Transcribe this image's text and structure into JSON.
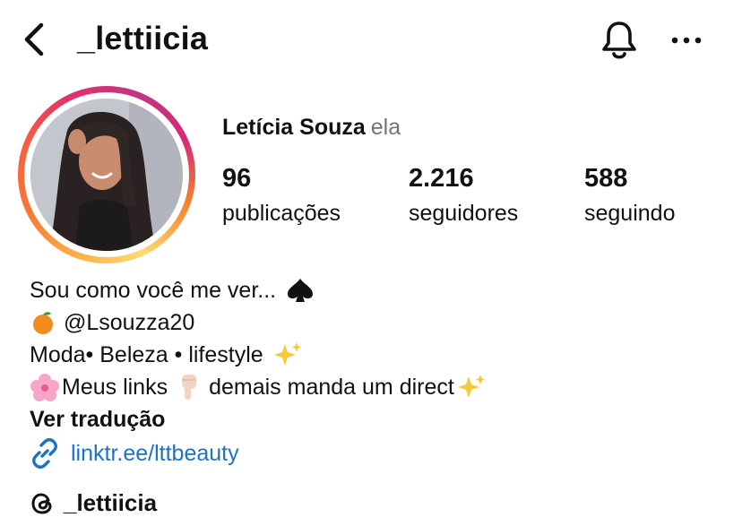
{
  "header": {
    "username": "_lettiicia"
  },
  "profile": {
    "full_name": "Letícia Souza",
    "pronoun": "ela",
    "stats": {
      "posts": {
        "value": "96",
        "label": "publicações"
      },
      "followers": {
        "value": "2.216",
        "label": "seguidores"
      },
      "following": {
        "value": "588",
        "label": "seguindo"
      }
    }
  },
  "bio": {
    "line1": "Sou como você me ver...",
    "line2": "@Lsouzza20",
    "line3": "Moda• Beleza • lifestyle",
    "line4_a": "Meus links",
    "line4_b": "demais manda um direct",
    "translate_label": "Ver tradução",
    "link": "linktr.ee/lttbeauty"
  },
  "threads": {
    "handle": "_lettiicia"
  },
  "colors": {
    "link_blue": "#1a73c6",
    "muted_gray": "#737373",
    "story_ring_start": "#fcaf45",
    "story_ring_end": "#c13584"
  },
  "icons": {
    "back": "chevron-left-icon",
    "bell": "bell-icon",
    "more": "more-horizontal-icon",
    "link": "link-icon",
    "threads": "threads-icon"
  }
}
